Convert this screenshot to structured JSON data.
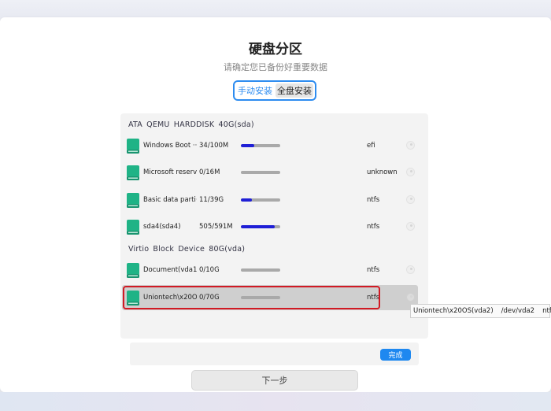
{
  "title": "硬盘分区",
  "subtitle": "请确定您已备份好重要数据",
  "mode_tabs": [
    {
      "label": "手动安装",
      "active": true
    },
    {
      "label": "全盘安装",
      "active": false
    }
  ],
  "disks": [
    {
      "header": "ATA  QEMU  HARDDISK  40G(sda)",
      "partitions": [
        {
          "name": "Windows Boot ···",
          "size": "34/100M",
          "usage": 0.34,
          "fs": "efi"
        },
        {
          "name": "Microsoft reserv···",
          "size": "0/16M",
          "usage": 0.0,
          "fs": "unknown"
        },
        {
          "name": "Basic data parti···",
          "size": "11/39G",
          "usage": 0.28,
          "fs": "ntfs"
        },
        {
          "name": "sda4(sda4)",
          "size": "505/591M",
          "usage": 0.85,
          "fs": "ntfs"
        }
      ]
    },
    {
      "header": "Virtio  Block  Device  80G(vda)",
      "partitions": [
        {
          "name": "Document(vda1)",
          "size": "0/10G",
          "usage": 0.0,
          "fs": "ntfs"
        },
        {
          "name": "Uniontech\\x20O···",
          "size": "0/70G",
          "usage": 0.0,
          "fs": "ntfs",
          "selected": true
        }
      ]
    }
  ],
  "tooltip": {
    "label": "Uniontech\\x20OS(vda2)",
    "path": "/dev/vda2",
    "fs": "ntfs"
  },
  "done_label": "完成",
  "next_label": "下一步",
  "colors": {
    "accent": "#2d8cf0",
    "usage_bar": "#1f1fd6",
    "selection_outline": "#d11a24",
    "disk_icon": "#1fb386"
  },
  "icons": {
    "partition": "disk-icon",
    "select": "radio-icon"
  }
}
